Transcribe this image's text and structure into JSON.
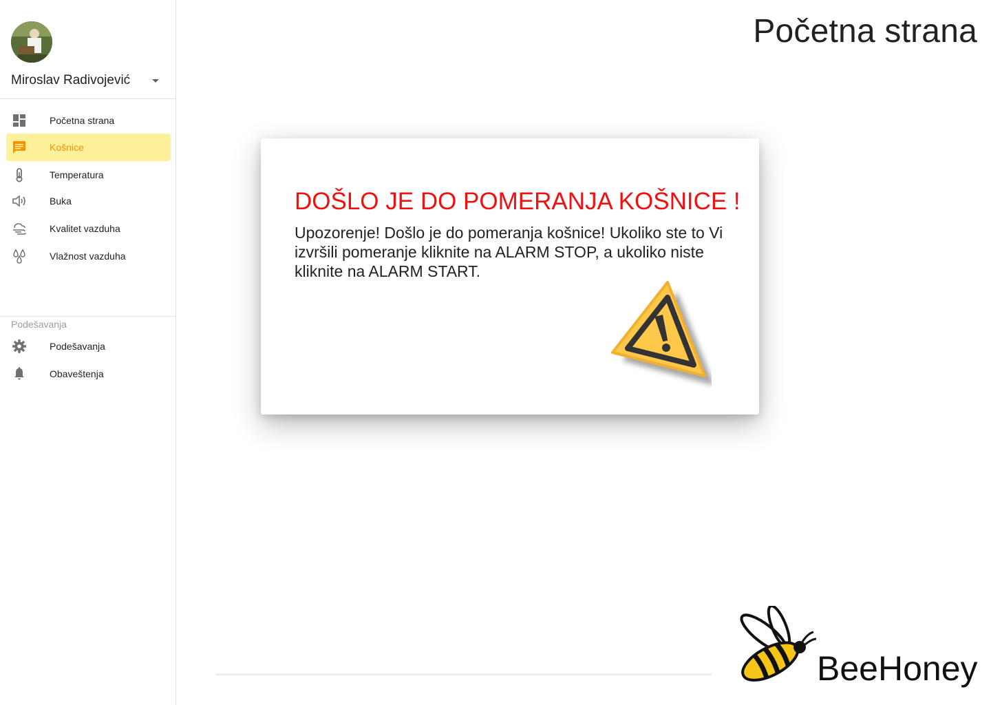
{
  "page": {
    "title": "Početna strana"
  },
  "user": {
    "name": "Miroslav Radivojević"
  },
  "nav": {
    "items": [
      {
        "label": "Početna strana",
        "icon": "dashboard-icon"
      },
      {
        "label": "Košnice",
        "icon": "message-icon",
        "active": true
      },
      {
        "label": "Temperatura",
        "icon": "thermometer-icon"
      },
      {
        "label": "Buka",
        "icon": "speaker-icon"
      },
      {
        "label": "Kvalitet vazduha",
        "icon": "air-icon"
      },
      {
        "label": "Vlažnost vazduha",
        "icon": "droplets-icon"
      }
    ],
    "settings_section": "Podešavanja",
    "settings_items": [
      {
        "label": "Podešavanja",
        "icon": "gear-icon"
      },
      {
        "label": "Obaveštenja",
        "icon": "bell-icon"
      }
    ]
  },
  "dialog": {
    "title": "DOŠLO JE DO POMERANJA KOŠNICE !",
    "text": "Upozorenje! Došlo je do pomeranja košnice! Ukoliko ste to Vi izvršili pomeranje kliknite na ALARM STOP, a ukoliko niste kliknite na ALARM START.",
    "icon": "warning-icon"
  },
  "brand": {
    "name": "BeeHoney",
    "icon": "bee-logo-icon"
  },
  "colors": {
    "accent": "#f59300",
    "active_bg": "#fff09c",
    "alert": "#ee1111",
    "warning": "#ffc84a"
  }
}
